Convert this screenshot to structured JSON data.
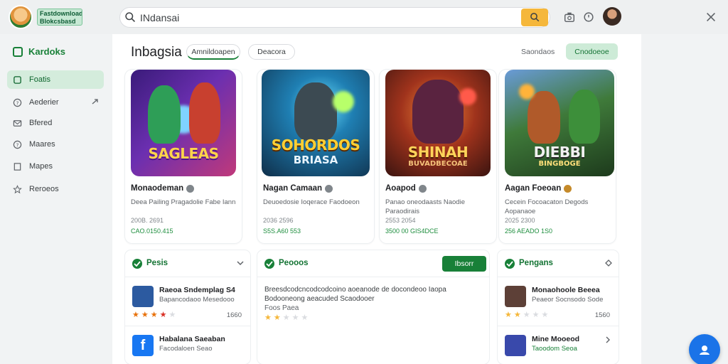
{
  "header": {
    "brand_text": "Fastdownload Blokcsbasd",
    "search_value": "INdansai",
    "search_placeholder": "Search"
  },
  "sidebar": {
    "title": "Kardoks",
    "items": [
      {
        "label": "Foatis",
        "icon": "home-icon",
        "active": true
      },
      {
        "label": "Aederier",
        "icon": "question-icon",
        "active": false
      },
      {
        "label": "Bfered",
        "icon": "mail-icon",
        "active": false
      },
      {
        "label": "Maares",
        "icon": "help-icon",
        "active": false
      },
      {
        "label": "Mapes",
        "icon": "bookmark-icon",
        "active": false
      },
      {
        "label": "Reroeos",
        "icon": "star-icon",
        "active": false
      }
    ]
  },
  "main": {
    "title": "Inbagsia",
    "chips": [
      "Amnildoapen",
      "Deacora"
    ],
    "right_link": "Saondaos",
    "right_button": "Cnodoeoe"
  },
  "games": [
    {
      "art_text": "SAGLEAS",
      "art_sub": "",
      "title": "Monaodeman",
      "desc": "Deea Pailing Pragadolie Fabe Iann",
      "meta": "200B. 2691",
      "price": "CAO.0150.415",
      "bg1": "#3a1b7a",
      "bg2": "#c0397a"
    },
    {
      "art_text": "SOHORDOS",
      "art_sub": "BRIASA",
      "title": "Nagan Camaan",
      "desc": "Deuoedosie Ioqerace Faodoeon",
      "meta": "2036 2596",
      "price": "S5S.A60 553",
      "bg1": "#0f4f7a",
      "bg2": "#3fb6c9"
    },
    {
      "art_text": "SHINAH",
      "art_sub": "BUVADBECOAE",
      "title": "Aoapod",
      "desc": "Panao oneodaasts Naodie Paraodirais",
      "meta": "2553 2054",
      "price": "3500 00 GIS4DCE",
      "bg1": "#3b1410",
      "bg2": "#d1612a"
    },
    {
      "art_text": "DIEBBI",
      "art_sub": "BINGBOGE",
      "title": "Aagan Foeoan",
      "desc": "Cecein Focoacaton Degods Aopanaoe",
      "meta": "2025 2300",
      "price": "256 AEADO 1S0",
      "bg1": "#1d5a2c",
      "bg2": "#5fb35a"
    }
  ],
  "panels": [
    {
      "title": "Pesis",
      "button": "",
      "rows": [
        {
          "title": "Raeoa Sndemplag S4",
          "sub": "Bapancodaoo Mesedooo",
          "stars": 4,
          "count": "1660",
          "thumb": "#2c5aa0"
        },
        {
          "title": "Habalana Saeaban",
          "sub": "Facodaloen Seao",
          "stars": 0,
          "count": "",
          "thumb": "#1877f2"
        }
      ]
    },
    {
      "title": "Peooos",
      "button": "Ibsorr",
      "text1": "Breesdcodcncodcodcoino aoeanode de docondeoo Iaopa",
      "text2": "Bodooneong aeacuded Scaodooer",
      "text3": "Foos Paea",
      "stars": 2
    },
    {
      "title": "Pengans",
      "button": "",
      "rows": [
        {
          "title": "Monaohoole Beeea",
          "sub": "Peaeor Socnsodo Sode",
          "stars": 2,
          "count": "1560",
          "thumb": "#5d4037"
        },
        {
          "title": "Mine Mooeod",
          "sub": "Taoodom Seoa",
          "stars": 0,
          "count": "",
          "thumb": "#3949ab"
        }
      ]
    }
  ],
  "colors": {
    "accent": "#188038",
    "search_button": "#f5b73b",
    "fab": "#1a73e8"
  }
}
